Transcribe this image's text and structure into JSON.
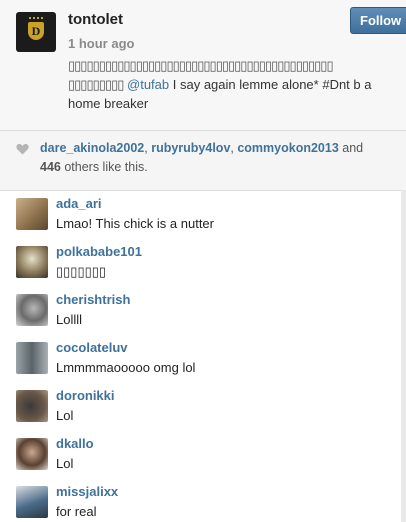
{
  "post": {
    "username": "tontolet",
    "time": "1 hour ago",
    "follow_label": "Follow",
    "caption_boxes_line": "▯▯▯▯▯▯▯▯▯▯▯▯▯▯▯▯▯▯▯▯▯▯▯▯▯▯▯▯▯▯▯▯▯▯▯▯▯▯▯▯▯▯▯",
    "caption_boxes_prefix": "▯▯▯▯▯▯▯▯▯",
    "caption_mention": "@tufab",
    "caption_text": " I say again lemme alone* #Dnt b a home breaker"
  },
  "likes": {
    "user1": "dare_akinola2002",
    "user2": "rubyruby4lov",
    "user3": "commyokon2013",
    "and": "and",
    "count": "446",
    "others": "others like this."
  },
  "comments": [
    {
      "user": "ada_ari",
      "text": "Lmao! This chick is a nutter"
    },
    {
      "user": "polkababe101",
      "text": "▯▯▯▯▯▯▯"
    },
    {
      "user": "cherishtrish",
      "text": "Lollll"
    },
    {
      "user": "cocolateluv",
      "text": "Lmmmmaooooo omg lol"
    },
    {
      "user": "doronikki",
      "text": "Lol"
    },
    {
      "user": "dkallo",
      "text": "Lol"
    },
    {
      "user": "missjalixx",
      "text": "for real"
    }
  ],
  "colors": {
    "link": "#3f729b",
    "follow_button": "#4b7ba7"
  }
}
